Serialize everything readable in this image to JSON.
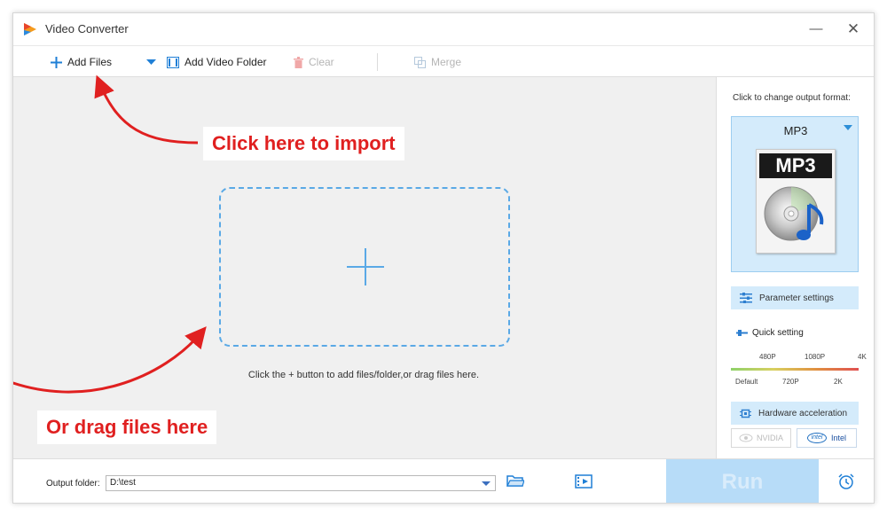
{
  "window": {
    "title": "Video Converter",
    "minimize_icon": "minimize-icon",
    "close_icon": "close-icon"
  },
  "toolbar": {
    "add_files": "Add Files",
    "add_video_folder": "Add Video Folder",
    "clear": "Clear",
    "merge": "Merge"
  },
  "main": {
    "hint": "Click the + button to add files/folder,or drag files here.",
    "callout_import": "Click here to import",
    "callout_drag": "Or drag files here"
  },
  "output_panel": {
    "label": "Click to change output format:",
    "format": "MP3",
    "format_icon_text": "MP3",
    "parameter_settings": "Parameter settings",
    "quick_setting": "Quick setting",
    "quality_top": [
      "480P",
      "1080P",
      "4K"
    ],
    "quality_bottom": [
      "Default",
      "720P",
      "2K"
    ],
    "hardware_acceleration": "Hardware acceleration",
    "nvidia": "NVIDIA",
    "intel": "Intel",
    "intel_logo": "intel"
  },
  "bottom": {
    "output_folder_label": "Output folder:",
    "output_folder_value": "D:\\test",
    "run": "Run"
  },
  "colors": {
    "accent_blue": "#5aa9e6",
    "callout_red": "#e02020",
    "run_button": "#b7dcf8",
    "format_card": "#d4ebfb"
  }
}
